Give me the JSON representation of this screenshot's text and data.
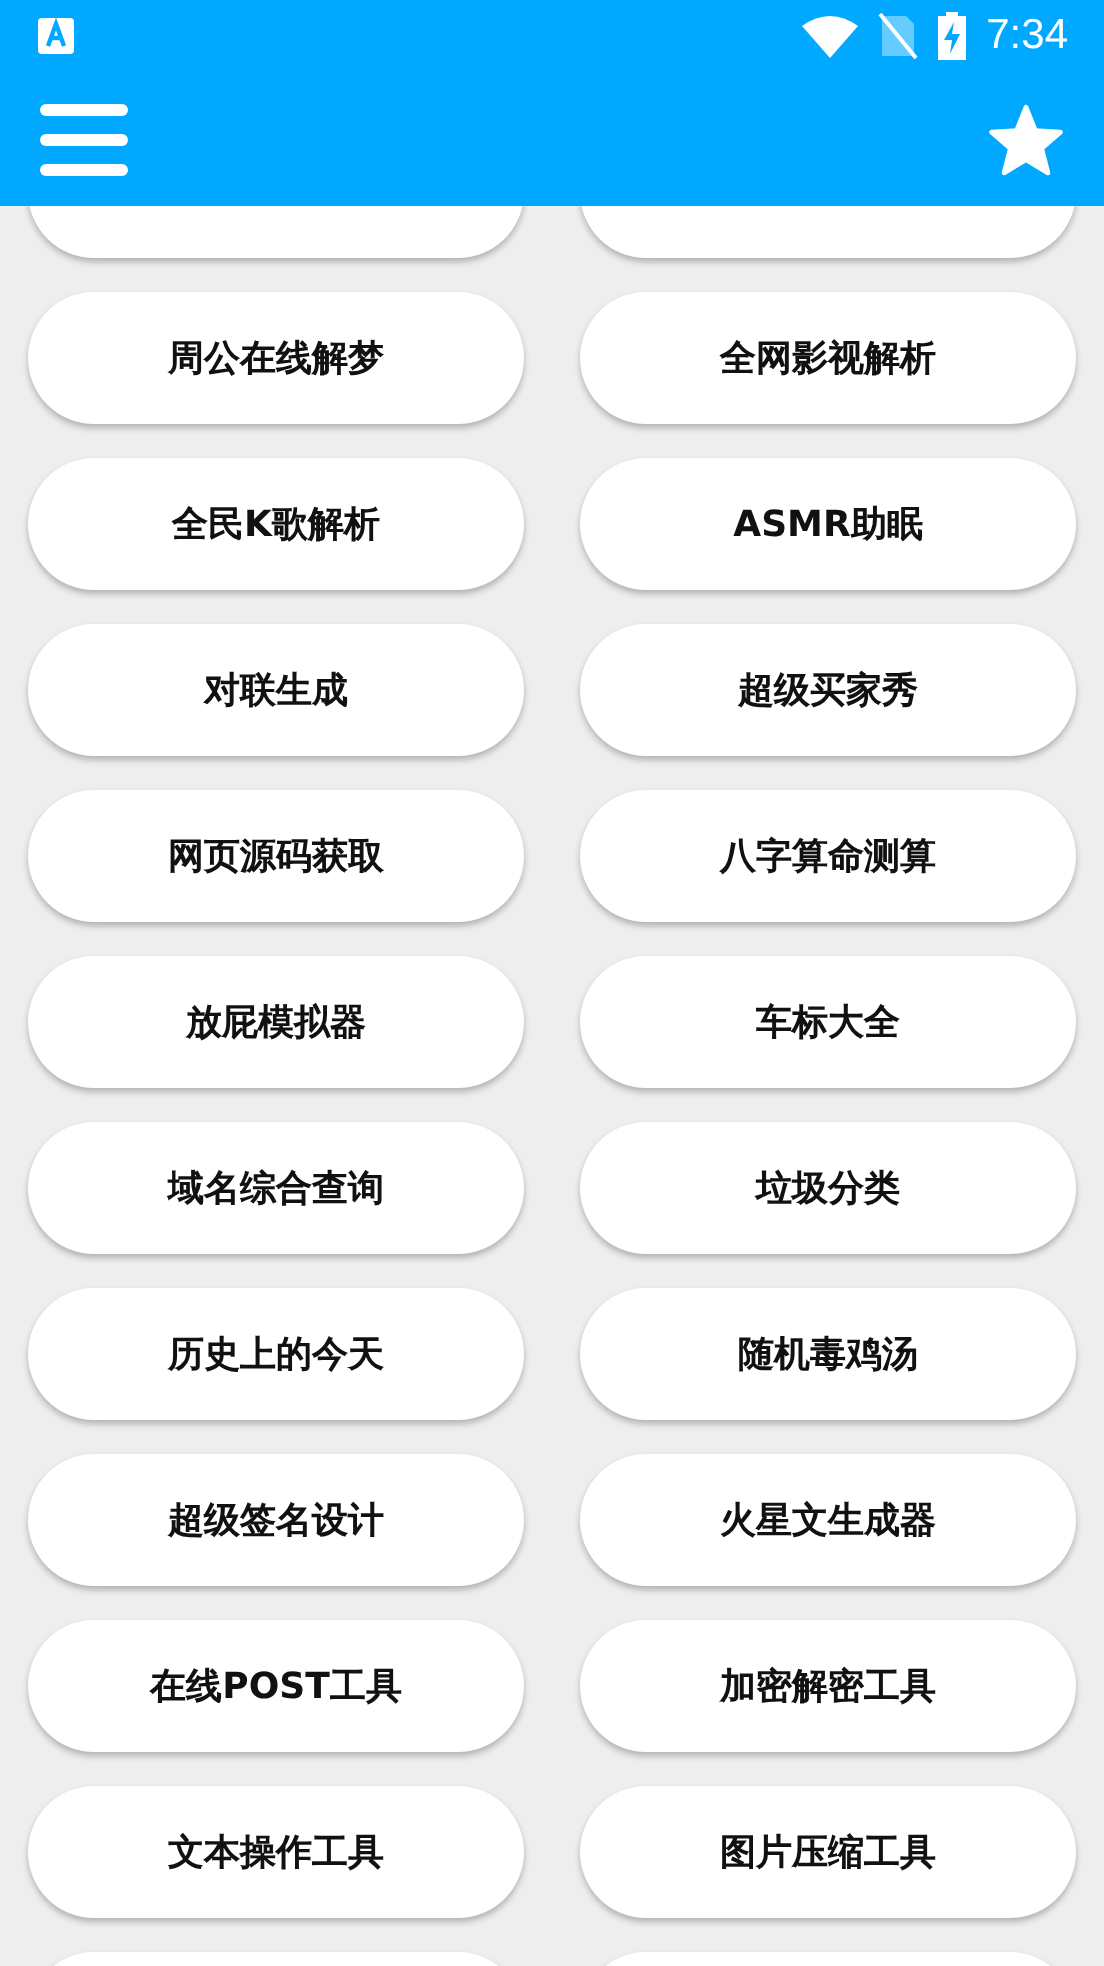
{
  "status_bar": {
    "time": "7:34"
  },
  "tools": [
    {
      "label": "周公在线解梦"
    },
    {
      "label": "全网影视解析"
    },
    {
      "label": "全民K歌解析"
    },
    {
      "label": "ASMR助眠"
    },
    {
      "label": "对联生成"
    },
    {
      "label": "超级买家秀"
    },
    {
      "label": "网页源码获取"
    },
    {
      "label": "八字算命测算"
    },
    {
      "label": "放屁模拟器"
    },
    {
      "label": "车标大全"
    },
    {
      "label": "域名综合查询"
    },
    {
      "label": "垃圾分类"
    },
    {
      "label": "历史上的今天"
    },
    {
      "label": "随机毒鸡汤"
    },
    {
      "label": "超级签名设计"
    },
    {
      "label": "火星文生成器"
    },
    {
      "label": "在线POST工具"
    },
    {
      "label": "加密解密工具"
    },
    {
      "label": "文本操作工具"
    },
    {
      "label": "图片压缩工具"
    }
  ]
}
